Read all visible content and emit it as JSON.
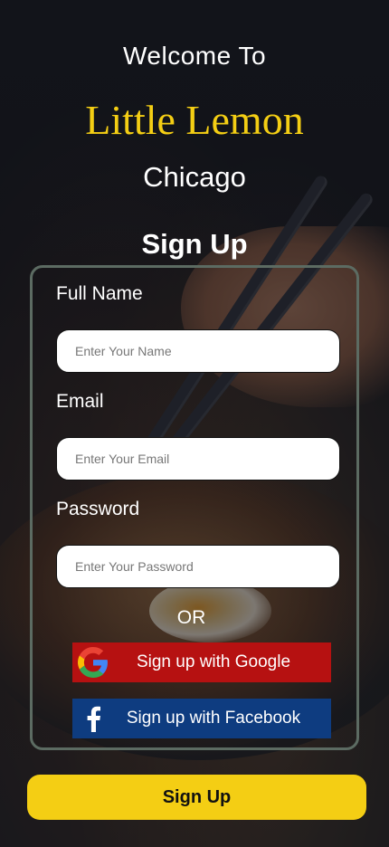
{
  "header": {
    "welcome": "Welcome To",
    "brand": "Little Lemon",
    "city": "Chicago"
  },
  "form": {
    "title": "Sign Up",
    "full_name": {
      "label": "Full Name",
      "placeholder": "Enter Your Name",
      "value": ""
    },
    "email": {
      "label": "Email",
      "placeholder": "Enter Your Email",
      "value": ""
    },
    "password": {
      "label": "Password",
      "placeholder": "Enter Your Password",
      "value": ""
    },
    "divider": "OR",
    "google": {
      "label": "Sign up with Google",
      "icon": "google-icon",
      "color": "#b61111"
    },
    "facebook": {
      "label": "Sign up with Facebook",
      "icon": "facebook-icon",
      "color": "#0e3c80"
    }
  },
  "submit_label": "Sign Up",
  "colors": {
    "brand": "#f4ce14",
    "card_border": "#5c6b62",
    "background": "#14151c"
  }
}
